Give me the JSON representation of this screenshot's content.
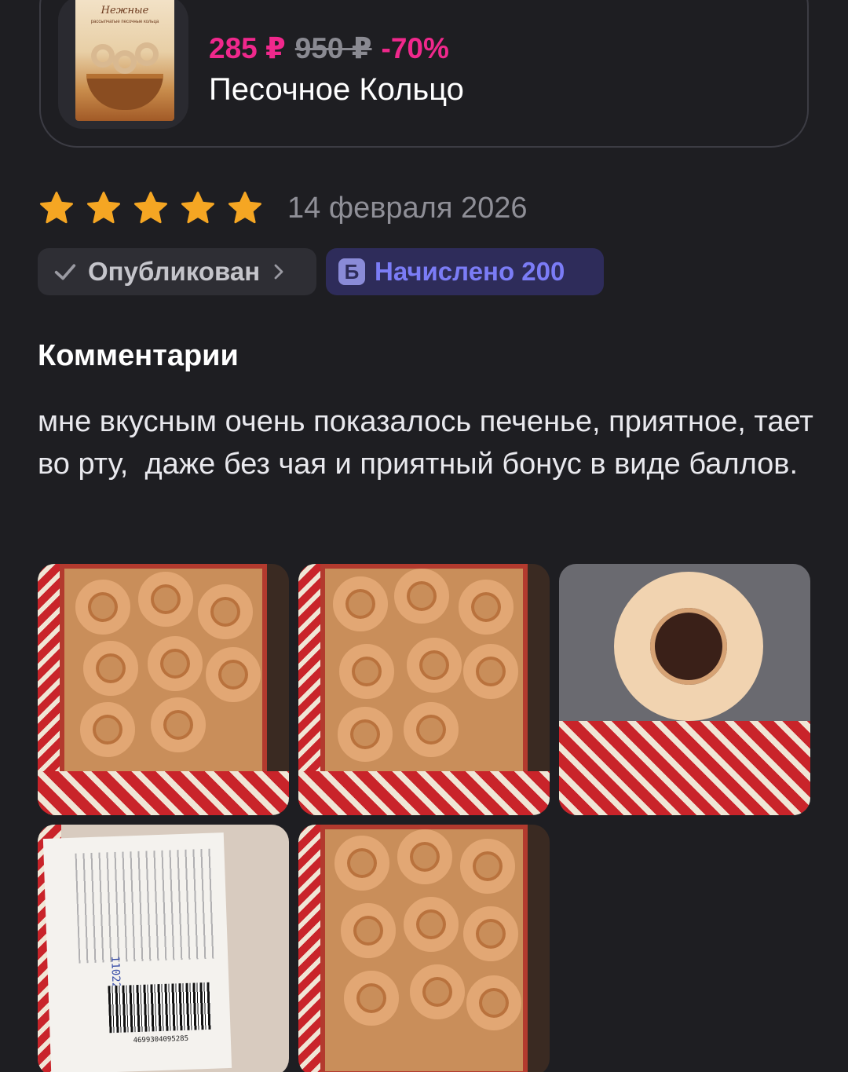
{
  "product": {
    "box_brand": "Нежные",
    "box_subtitle": "рассыпчатые песочные кольца",
    "price_current": "285 ₽",
    "price_old": "950 ₽",
    "discount": "-70%",
    "name": "Песочное Кольцо"
  },
  "review": {
    "rating": 5,
    "rating_max": 5,
    "date": "14 февраля 2026",
    "status_label": "Опубликован",
    "bonus_icon_letter": "Б",
    "bonus_label": "Начислено 200"
  },
  "comments": {
    "title": "Комментарии",
    "text": "мне вкусным очень показалось печенье, приятное, тает во рту,  даже без чая и приятный бонус в виде баллов."
  },
  "photos": {
    "count": 5,
    "label_code": "110226",
    "barcode_number": "4699304095285"
  },
  "colors": {
    "background": "#1e1e22",
    "price_accent": "#f0288c",
    "star": "#f5a623",
    "bonus_text": "#7b7cf6"
  },
  "icons": {
    "star": "star-icon",
    "check": "check-icon",
    "chevron": "chevron-right-icon",
    "bonus": "bonus-points-icon"
  }
}
